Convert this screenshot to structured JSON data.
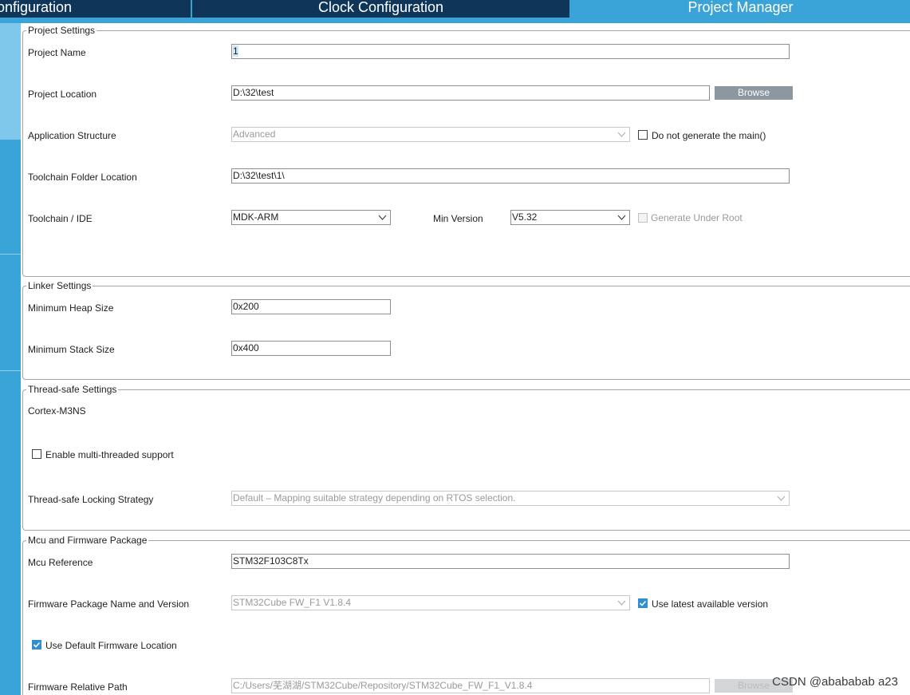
{
  "tabs": [
    {
      "label": "onfiguration"
    },
    {
      "label": "Clock Configuration"
    },
    {
      "label": "Project Manager"
    }
  ],
  "project_settings": {
    "title": "Project Settings",
    "project_name_label": "Project Name",
    "project_name_value": "1",
    "project_location_label": "Project Location",
    "project_location_value": "D:\\32\\test",
    "browse_label": "Browse",
    "app_structure_label": "Application Structure",
    "app_structure_value": "Advanced",
    "no_main_label": "Do not generate the main()",
    "toolchain_folder_label": "Toolchain Folder Location",
    "toolchain_folder_value": "D:\\32\\test\\1\\",
    "toolchain_ide_label": "Toolchain / IDE",
    "toolchain_ide_value": "MDK-ARM",
    "min_version_label": "Min Version",
    "min_version_value": "V5.32",
    "generate_under_root_label": "Generate Under Root"
  },
  "linker_settings": {
    "title": "Linker Settings",
    "heap_label": "Minimum Heap Size",
    "heap_value": "0x200",
    "stack_label": "Minimum Stack Size",
    "stack_value": "0x400"
  },
  "thread_safe": {
    "title": "Thread-safe Settings",
    "core_label": "Cortex-M3NS",
    "multithread_label": "Enable multi-threaded support",
    "locking_label": "Thread-safe Locking Strategy",
    "locking_value": "Default  –  Mapping suitable strategy depending on RTOS selection."
  },
  "mcu_firmware": {
    "title": "Mcu and Firmware Package",
    "mcu_ref_label": "Mcu Reference",
    "mcu_ref_value": "STM32F103C8Tx",
    "fw_pkg_label": "Firmware Package Name and Version",
    "fw_pkg_value": "STM32Cube FW_F1 V1.8.4",
    "use_latest_label": "Use latest available version",
    "use_default_fw_label": "Use Default Firmware Location",
    "fw_rel_path_label": "Firmware Relative Path",
    "fw_rel_path_value": "C:/Users/芜湖湖/STM32Cube/Repository/STM32Cube_FW_F1_V1.8.4",
    "browse_label": "Browse"
  },
  "watermark": "CSDN @abababab a23",
  "colors": {
    "tab_active": "#3aa3d8",
    "tab_inactive": "#0f3658",
    "button": "#8d979f",
    "checkbox_checked": "#2f8fd0"
  }
}
